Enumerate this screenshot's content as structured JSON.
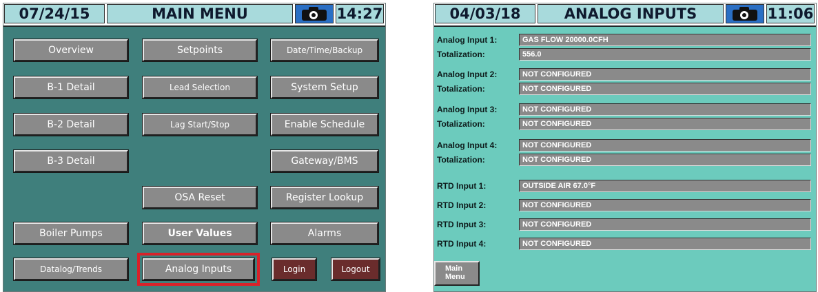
{
  "main_menu": {
    "header": {
      "date": "07/24/15",
      "title": "MAIN MENU",
      "camera_icon": "camera-icon",
      "time": "14:27"
    },
    "buttons": {
      "overview": "Overview",
      "setpoints": "Setpoints",
      "date_time_backup": "Date/Time/Backup",
      "b1_detail": "B-1 Detail",
      "lead_selection": "Lead Selection",
      "system_setup": "System Setup",
      "b2_detail": "B-2 Detail",
      "lag_start_stop": "Lag Start/Stop",
      "enable_schedule": "Enable Schedule",
      "b3_detail": "B-3 Detail",
      "gateway_bms": "Gateway/BMS",
      "osa_reset": "OSA Reset",
      "register_lookup": "Register Lookup",
      "boiler_pumps": "Boiler Pumps",
      "user_values": "User Values",
      "alarms": "Alarms",
      "datalog_trends": "Datalog/Trends",
      "analog_inputs": "Analog Inputs",
      "login": "Login",
      "logout": "Logout"
    },
    "colors": {
      "background": "#3f7f7c",
      "highlight": "#d8222a"
    }
  },
  "analog_inputs": {
    "header": {
      "date": "04/03/18",
      "title": "ANALOG INPUTS",
      "camera_icon": "camera-icon",
      "time": "11:06"
    },
    "rows": [
      {
        "label": "Analog Input 1:",
        "value": "GAS FLOW 20000.0CFH"
      },
      {
        "label": "Totalization:",
        "value": "556.0"
      },
      {
        "label": "Analog Input 2:",
        "value": "NOT CONFIGURED"
      },
      {
        "label": "Totalization:",
        "value": "NOT CONFIGURED"
      },
      {
        "label": "Analog Input 3:",
        "value": "NOT CONFIGURED"
      },
      {
        "label": "Totalization:",
        "value": "NOT CONFIGURED"
      },
      {
        "label": "Analog Input 4:",
        "value": "NOT CONFIGURED"
      },
      {
        "label": "Totalization:",
        "value": "NOT CONFIGURED"
      },
      {
        "label": "RTD Input 1:",
        "value": "OUTSIDE AIR 67.0°F"
      },
      {
        "label": "RTD Input 2:",
        "value": "NOT CONFIGURED"
      },
      {
        "label": "RTD Input 3:",
        "value": "NOT CONFIGURED"
      },
      {
        "label": "RTD Input 4:",
        "value": "NOT CONFIGURED"
      }
    ],
    "main_menu_button": {
      "line1": "Main",
      "line2": "Menu"
    },
    "colors": {
      "background": "#6ccbbd"
    }
  }
}
